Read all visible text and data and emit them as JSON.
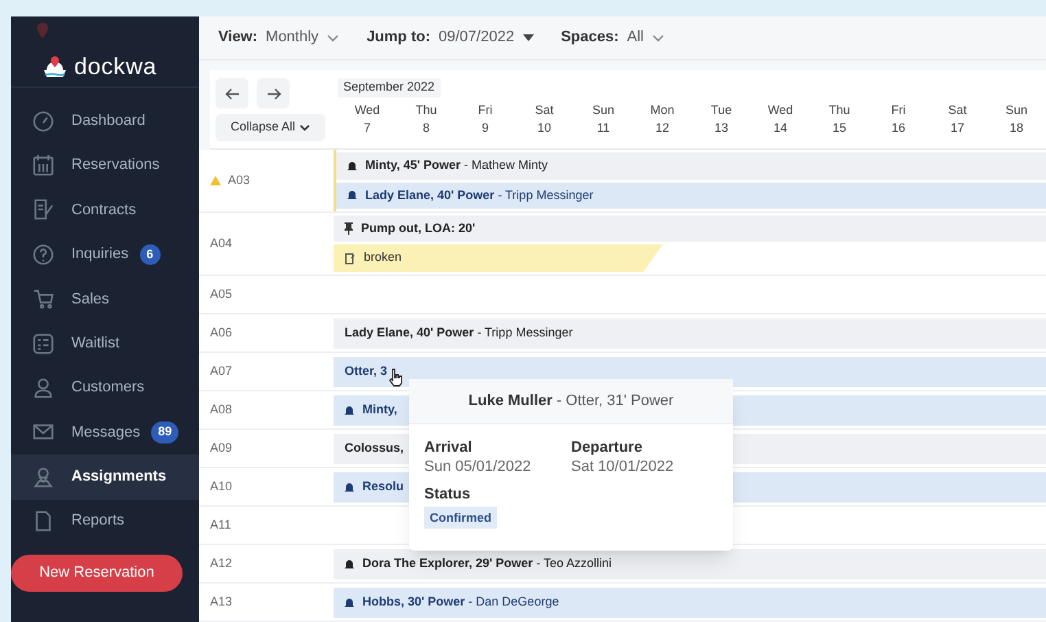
{
  "sidebar": {
    "logo": "dockwa",
    "items": [
      {
        "label": "Dashboard",
        "selected": false
      },
      {
        "label": "Reservations",
        "selected": false
      },
      {
        "label": "Contracts",
        "selected": false
      },
      {
        "label": "Inquiries",
        "badge": "6",
        "selected": false
      },
      {
        "label": "Sales",
        "selected": false
      },
      {
        "label": "Waitlist",
        "selected": false
      },
      {
        "label": "Customers",
        "selected": false
      },
      {
        "label": "Messages",
        "badge": "89",
        "selected": false
      },
      {
        "label": "Assignments",
        "selected": true
      },
      {
        "label": "Reports",
        "selected": false
      }
    ],
    "new_button": "New Reservation"
  },
  "toolbar": [
    {
      "label": "View:",
      "value": "Monthly",
      "kind": "chevron"
    },
    {
      "label": "Jump to:",
      "value": "09/07/2022",
      "kind": "caret"
    },
    {
      "label": "Spaces:",
      "value": "All",
      "kind": "chevron"
    }
  ],
  "calendar": {
    "month": "September 2022",
    "collapse": "Collapse All",
    "days": [
      {
        "weekday": "Wed",
        "date": "7"
      },
      {
        "weekday": "Thu",
        "date": "8"
      },
      {
        "weekday": "Fri",
        "date": "9"
      },
      {
        "weekday": "Sat",
        "date": "10"
      },
      {
        "weekday": "Sun",
        "date": "11"
      },
      {
        "weekday": "Mon",
        "date": "12"
      },
      {
        "weekday": "Tue",
        "date": "13"
      },
      {
        "weekday": "Wed",
        "date": "14"
      },
      {
        "weekday": "Thu",
        "date": "15"
      },
      {
        "weekday": "Fri",
        "date": "16"
      },
      {
        "weekday": "Sat",
        "date": "17"
      },
      {
        "weekday": "Sun",
        "date": "18"
      }
    ],
    "rows": [
      {
        "space": "A03",
        "warning": true,
        "bookings": [
          {
            "kind": "reservation",
            "confirmed": false,
            "alert": true,
            "boat": "Minty, 45' Power",
            "guest": " - Mathew Minty"
          },
          {
            "kind": "reservation",
            "confirmed": true,
            "alert": true,
            "boat": "Lady Elane, 40' Power",
            "guest": " - Tripp Messinger"
          }
        ]
      },
      {
        "space": "A04",
        "warning": false,
        "bookings": [
          {
            "kind": "service",
            "boat": "Pump out, LOA: 20'"
          },
          {
            "kind": "note",
            "boat": "broken"
          }
        ]
      },
      {
        "space": "A05",
        "warning": false,
        "bookings": []
      },
      {
        "space": "A06",
        "warning": false,
        "bookings": [
          {
            "kind": "reservation",
            "confirmed": false,
            "alert": false,
            "boat": "Lady Elane, 40' Power",
            "guest": " - Tripp Messinger"
          }
        ]
      },
      {
        "space": "A07",
        "warning": false,
        "bookings": [
          {
            "kind": "reservation",
            "confirmed": true,
            "alert": false,
            "boat": "Otter, 3"
          }
        ]
      },
      {
        "space": "A08",
        "warning": false,
        "bookings": [
          {
            "kind": "reservation",
            "confirmed": true,
            "alert": true,
            "boat": "Minty,"
          }
        ]
      },
      {
        "space": "A09",
        "warning": false,
        "bookings": [
          {
            "kind": "reservation",
            "confirmed": false,
            "alert": false,
            "boat": "Colossus,"
          }
        ]
      },
      {
        "space": "A10",
        "warning": false,
        "bookings": [
          {
            "kind": "reservation",
            "confirmed": true,
            "alert": true,
            "boat": "Resolu"
          }
        ]
      },
      {
        "space": "A11",
        "warning": false,
        "bookings": []
      },
      {
        "space": "A12",
        "warning": false,
        "bookings": [
          {
            "kind": "reservation",
            "confirmed": false,
            "alert": true,
            "boat": "Dora The Explorer, 29' Power",
            "guest": " - Teo Azzollini"
          }
        ]
      },
      {
        "space": "A13",
        "warning": false,
        "bookings": [
          {
            "kind": "reservation",
            "confirmed": true,
            "alert": true,
            "boat": "Hobbs, 30' Power",
            "guest": " - Dan DeGeorge"
          }
        ]
      }
    ]
  },
  "tooltip": {
    "guest": "Luke Muller",
    "boat": " - Otter, 31' Power",
    "arrival_label": "Arrival",
    "arrival": "Sun 05/01/2022",
    "departure_label": "Departure",
    "departure": "Sat 10/01/2022",
    "status_label": "Status",
    "status": "Confirmed"
  }
}
